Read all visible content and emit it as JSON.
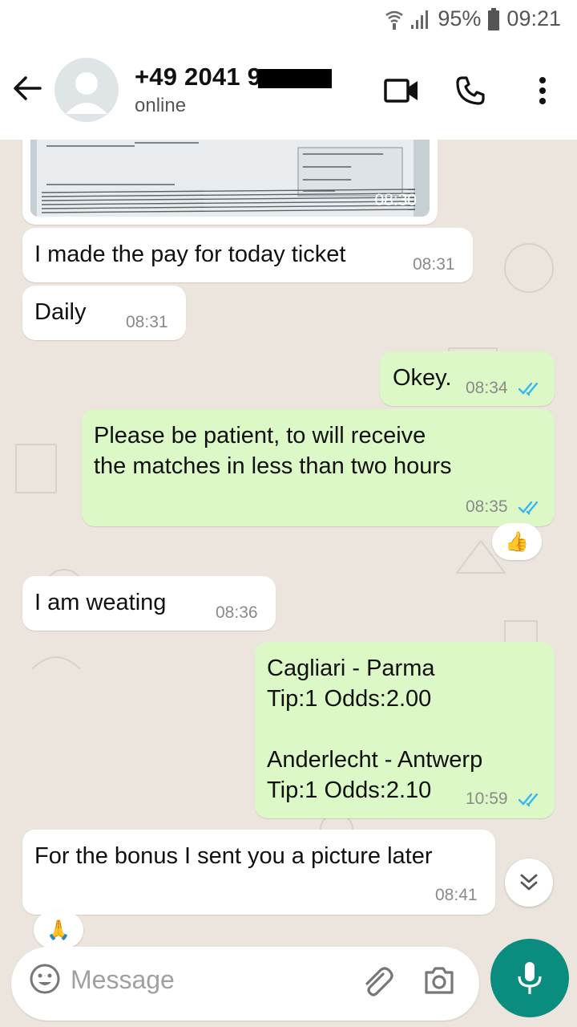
{
  "status_bar": {
    "battery": "95%",
    "time": "09:21"
  },
  "header": {
    "contact_name": "+49 2041 9",
    "contact_status": "online"
  },
  "messages": [
    {
      "dir": "in",
      "type": "image",
      "time": "08:30"
    },
    {
      "dir": "in",
      "text": "I made the pay for today ticket",
      "time": "08:31"
    },
    {
      "dir": "in",
      "text": "Daily",
      "time": "08:31"
    },
    {
      "dir": "out",
      "text": "Okey.",
      "time": "08:34"
    },
    {
      "dir": "out",
      "text": "Please be patient, to will receive\nthe matches in less than two hours",
      "time": "08:35"
    },
    {
      "dir": "in",
      "text": "I am weating",
      "time": "08:36"
    },
    {
      "dir": "out",
      "text": "Cagliari - Parma\nTip:1  Odds:2.00\n\nAnderlecht - Antwerp\nTip:1  Odds:2.10",
      "time": "10:59"
    },
    {
      "dir": "in",
      "text": "For the bonus I sent you a picture later",
      "time": "08:41"
    }
  ],
  "reactions": {
    "thumbs": "👍",
    "pray": "🙏"
  },
  "input": {
    "placeholder": "Message"
  },
  "colors": {
    "outgoing": "#dcf8c6",
    "incoming": "#ffffff",
    "accent": "#0a8d7e",
    "ticks": "#34b7f1"
  },
  "icons": [
    "back-arrow-icon",
    "video-call-icon",
    "phone-icon",
    "more-vert-icon",
    "emoji-icon",
    "attach-icon",
    "camera-icon",
    "mic-icon",
    "chevron-double-down-icon"
  ]
}
